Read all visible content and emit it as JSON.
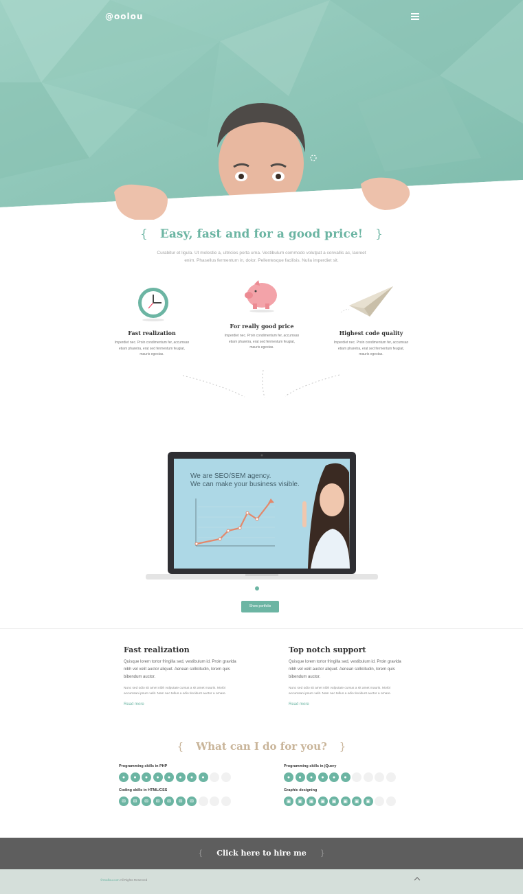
{
  "header": {
    "logo": "@oolou"
  },
  "intro": {
    "brace_open": "{",
    "title": "Easy, fast and for a good price!",
    "brace_close": "}",
    "text": "Curabitur et ligula. Ut molestie a, ultricies porta urna. Vestibulum commodo volutpat a convallis ac, laoreet enim. Phasellus fermentum in, dolor. Pellentesque facilisis. Nulla imperdiet sit."
  },
  "features": [
    {
      "title": "Fast realization",
      "text": "Imperdiet nec. Proin condimentum fer, accumsan etiam pharetra, erat sed fermentum feugiat, mauris egestas."
    },
    {
      "title": "For really good price",
      "text": "Imperdiet nec. Proin condimentum fer, accumsan etiam pharetra, erat sed fermentum feugiat, mauris egestas."
    },
    {
      "title": "Highest code quality",
      "text": "Imperdiet nec. Proin condimentum fer, accumsan etiam pharetra, erat sed fermentum feugiat, mauris egestas."
    }
  ],
  "showcase": {
    "line1": "We are  SEO/SEM agency.",
    "line2": "We can make your business visible.",
    "button": "Show portfolio"
  },
  "columns": [
    {
      "title": "Fast realization",
      "lead": "Quisque lorem tortor fringilla sed, vestibulum id. Proin gravida nibh vel velit auctor aliquet. Aenean sollicitudin, lorem quis bibendum auctor.",
      "small": "Nunc sed odio sit amet nibh vulputate cursus a sit amet mauris. Morbi accumsan ipsum velit. Nam nec tellus a odio tincidunt auctor a ornare.",
      "more": "Read more"
    },
    {
      "title": "Top notch support",
      "lead": "Quisque lorem tortor fringilla sed, vestibulum id. Proin gravida nibh vel velit auctor aliquet. Aenean sollicitudin, lorem quis bibendum auctor.",
      "small": "Nunc sed odio sit amet nibh vulputate cursus a sit amet mauris. Morbi accumsan ipsum velit. Nam nec tellus a odio tincidunt auctor a ornare.",
      "more": "Read more"
    }
  ],
  "skills": {
    "brace_open": "{",
    "title": "What can I do for you?",
    "brace_close": "}",
    "items": [
      {
        "label": "Programming skills in PHP",
        "level": 8,
        "max": 10,
        "icon": "lightbulb-icon"
      },
      {
        "label": "Programming skills in jQuery",
        "level": 6,
        "max": 10,
        "icon": "lightbulb-icon"
      },
      {
        "label": "Coding skills in HTML/CSS",
        "level": 7,
        "max": 10,
        "icon": "envelope-icon"
      },
      {
        "label": "Graphic designing",
        "level": 8,
        "max": 10,
        "icon": "camera-icon"
      }
    ]
  },
  "footer": {
    "hire_brace_open": "{",
    "hire": "Click here to hire me",
    "hire_brace_close": "}",
    "brand": "©Oodlou.com",
    "rights": " All Rights Reserved"
  },
  "colors": {
    "accent": "#6cb5a3",
    "hero": "#8cc4b6",
    "skills_title": "#c9b59a",
    "hire_bar": "#5e5e5e",
    "footer": "#d5dfda"
  }
}
